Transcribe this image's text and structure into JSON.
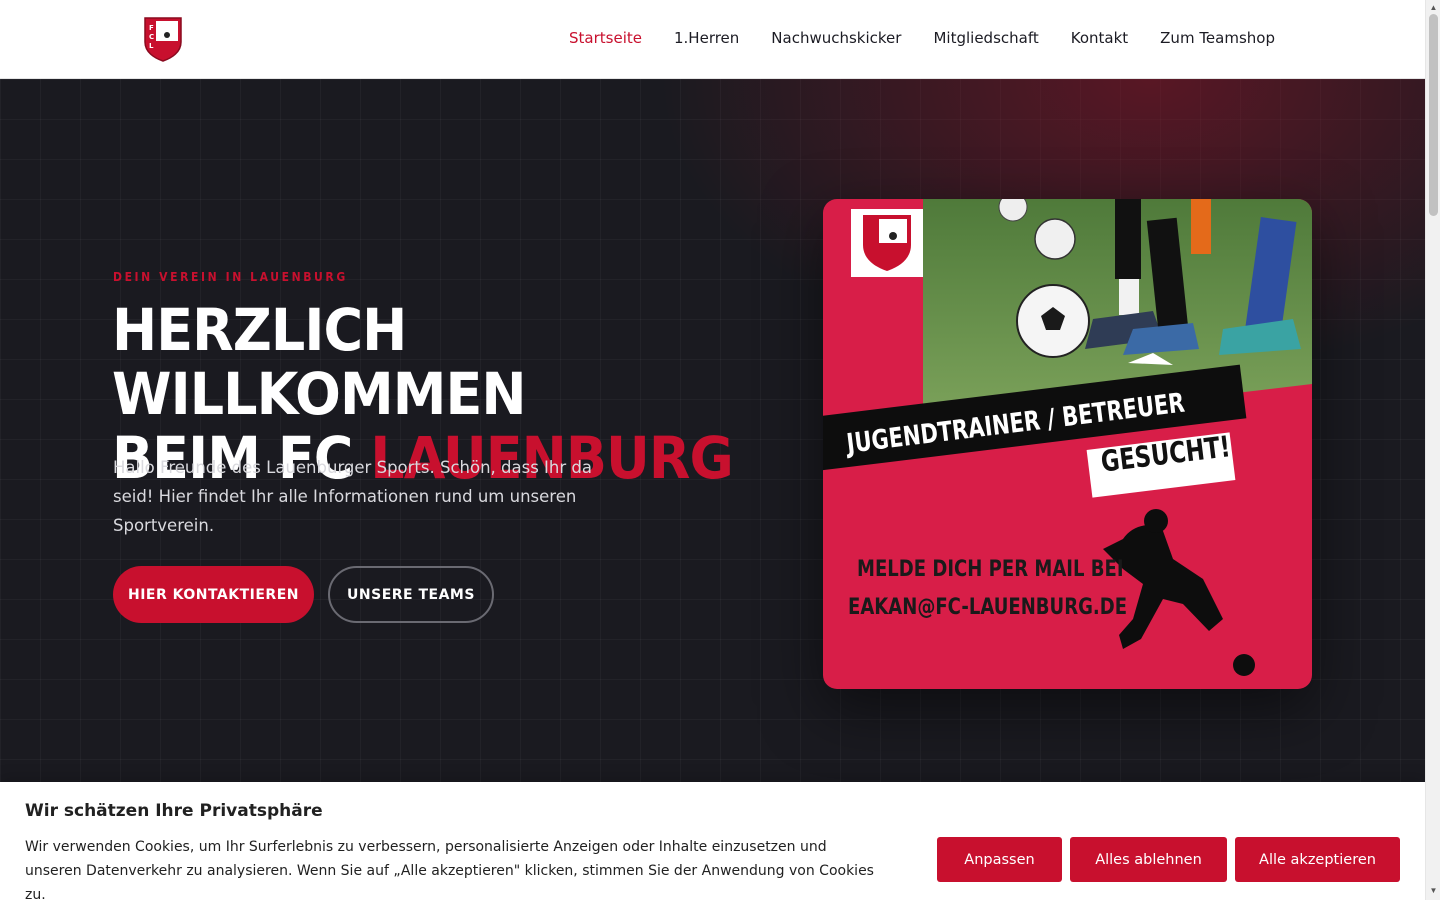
{
  "header": {
    "logo_text": "FCL",
    "nav": [
      {
        "label": "Startseite",
        "active": true
      },
      {
        "label": "1.Herren",
        "active": false
      },
      {
        "label": "Nachwuchskicker",
        "active": false
      },
      {
        "label": "Mitgliedschaft",
        "active": false
      },
      {
        "label": "Kontakt",
        "active": false
      },
      {
        "label": "Zum Teamshop",
        "active": false
      }
    ]
  },
  "hero": {
    "eyebrow": "DEIN VEREIN IN LAUENBURG",
    "title_line1": "HERZLICH WILLKOMMEN",
    "title_line2_prefix": "BEIM FC ",
    "title_line2_accent": "LAUENBURG",
    "intro": "Hallo Freunde des Lauenburger Sports. Schön, dass Ihr da seid! Hier findet Ihr alle Informationen rund um unseren Sportverein.",
    "primary_button": "HIER KONTAKTIEREN",
    "secondary_button": "UNSERE TEAMS",
    "card": {
      "banner": "JUGENDTRAINER / BETREUER",
      "gesucht": "GESUCHT!",
      "mail_line1": "MELDE DICH PER MAIL BEI",
      "mail_line2": "EAKAN@FC-LAUENBURG.DE"
    }
  },
  "cookie": {
    "title": "Wir schätzen Ihre Privatsphäre",
    "text": "Wir verwenden Cookies, um Ihr Surferlebnis zu verbessern, personalisierte Anzeigen oder Inhalte einzusetzen und unseren Datenverkehr zu analysieren. Wenn Sie auf „Alle akzeptieren\" klicken, stimmen Sie der Anwendung von Cookies zu.",
    "adjust": "Anpassen",
    "reject": "Alles ablehnen",
    "accept": "Alle akzeptieren"
  },
  "colors": {
    "accent": "#c8102e",
    "hero_bg": "#1a1a20",
    "card_bg": "#d81e48"
  }
}
